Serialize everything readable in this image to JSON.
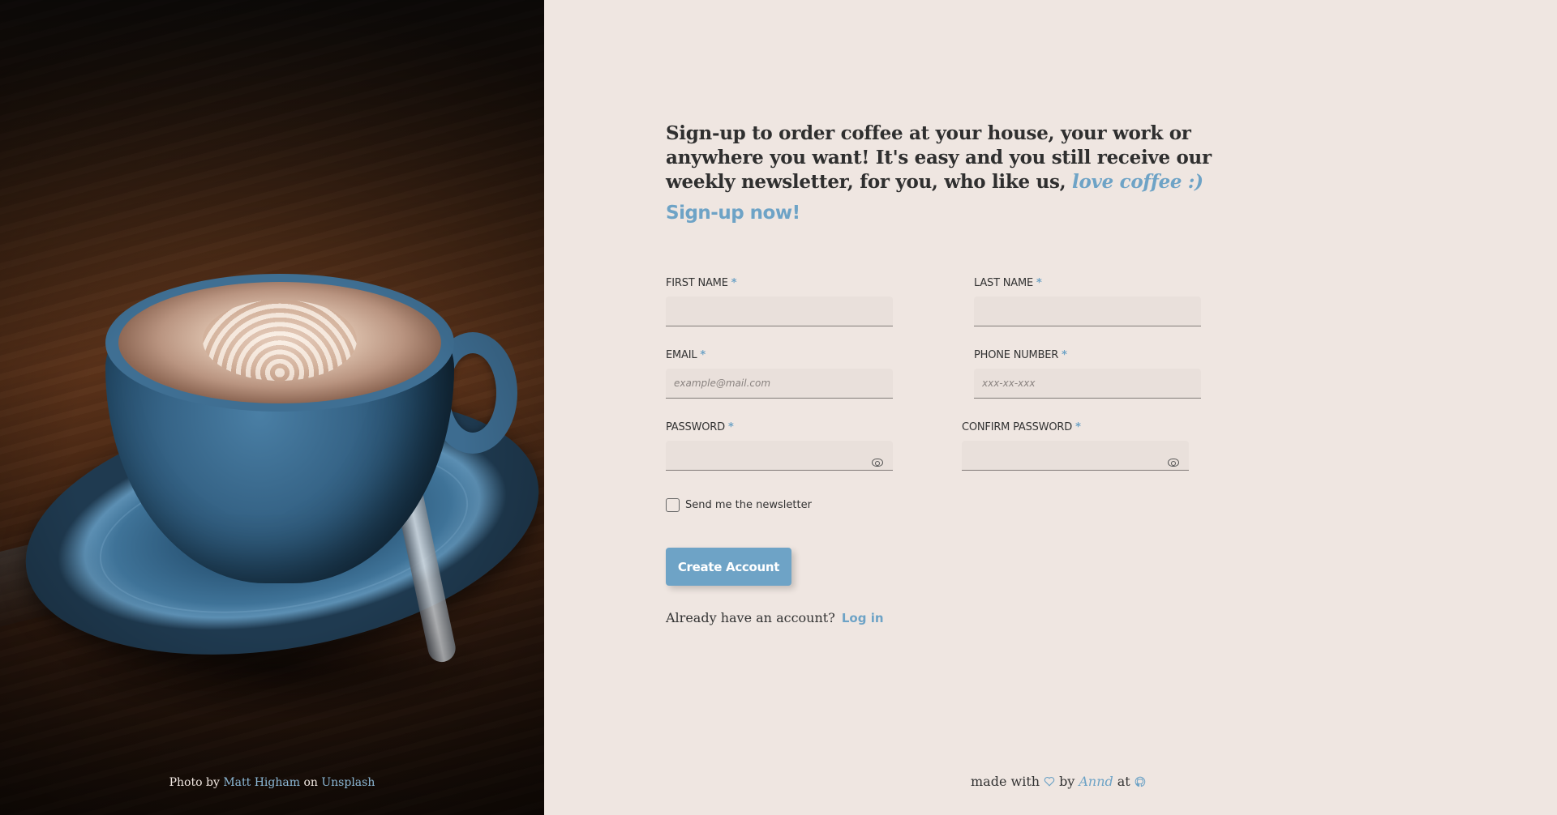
{
  "photo": {
    "credit_prefix": "Photo by",
    "author": "Matt Higham",
    "on": "on",
    "source": "Unsplash"
  },
  "intro": {
    "text": "Sign-up to order coffee at your house, your work or anywhere you want! It's easy and you still receive our weekly newsletter, for you, who like us,",
    "highlight": "love coffee :)"
  },
  "signup_title": "Sign-up now!",
  "form": {
    "first_name": {
      "label": "FIRST NAME",
      "required": "*",
      "value": "",
      "placeholder": ""
    },
    "last_name": {
      "label": "LAST NAME",
      "required": "*",
      "value": "",
      "placeholder": ""
    },
    "email": {
      "label": "EMAIL",
      "required": "*",
      "value": "",
      "placeholder": "example@mail.com"
    },
    "phone": {
      "label": "PHONE NUMBER",
      "required": "*",
      "value": "",
      "placeholder": "xxx-xx-xxx"
    },
    "password": {
      "label": "PASSWORD",
      "required": "*",
      "value": "",
      "placeholder": ""
    },
    "confirm_password": {
      "label": "CONFIRM PASSWORD",
      "required": "*",
      "value": "",
      "placeholder": ""
    },
    "newsletter_label": "Send me the newsletter",
    "newsletter_checked": false,
    "submit_label": "Create Account"
  },
  "login": {
    "prompt": "Already have an account?",
    "link": "Log in"
  },
  "footer": {
    "made_with": "made with",
    "by": "by",
    "author": "Annd",
    "at": "at"
  },
  "colors": {
    "accent": "#6ea3c6",
    "background": "#efe6e1",
    "input_bg": "#e9e0db"
  },
  "icons": {
    "password_toggle": "eye-icon",
    "heart": "heart-icon",
    "github": "github-icon"
  }
}
